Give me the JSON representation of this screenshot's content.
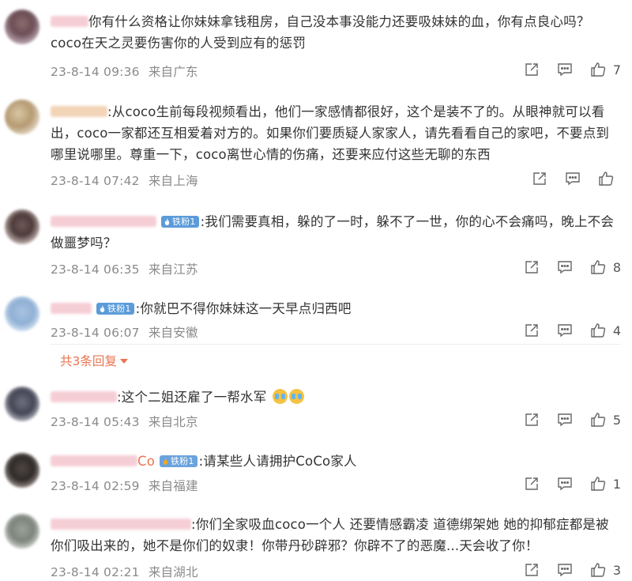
{
  "comments": [
    {
      "text_main": "你有什么资格让你妹妹拿钱租房，自己没本事没能力还要吸妹妹的血，你有点良心吗？",
      "text_line2": "coco在天之灵要伤害你的人受到应有的惩罚",
      "time": "23-8-14 09:36",
      "location": "来自广东",
      "likes": "7"
    },
    {
      "text": ":从coco生前每段视频看出，他们一家感情都很好，这个是装不了的。从眼神就可以看出，coco一家都还互相爱着对方的。如果你们要质疑人家家人，请先看看自己的家吧，不要点到哪里说哪里。尊重一下，coco离世心情的伤痛，还要来应付这些无聊的东西",
      "time": "23-8-14 07:42",
      "location": "来自上海",
      "likes": ""
    },
    {
      "badge": "铁粉1",
      "text": ":我们需要真相，躲的了一时，躲不了一世，你的心不会痛吗，晚上不会做噩梦吗？",
      "time": "23-8-14 06:35",
      "location": "来自江苏",
      "likes": "8"
    },
    {
      "badge": "铁粉1",
      "text": ":你就巴不得你妹妹这一天早点归西吧",
      "time": "23-8-14 06:07",
      "location": "来自安徽",
      "likes": "4",
      "replies_label": "共3条回复"
    },
    {
      "text": ":这个二姐还雇了一帮水军",
      "time": "23-8-14 05:43",
      "location": "来自北京",
      "likes": "5"
    },
    {
      "user_tail": "Co",
      "badge": "铁粉1",
      "text": ":请某些人请拥护CoCo家人",
      "time": "23-8-14 02:59",
      "location": "来自福建",
      "likes": "1"
    },
    {
      "text": ":你们全家吸血coco一个人 还要情感霸凌 道德绑架她 她的抑郁症都是被你们吸出来的，她不是你们的奴隶！你带丹砂辟邪？你辟不了的恶魔...天会收了你！",
      "time": "23-8-14 02:21",
      "location": "来自湖北",
      "likes": "3"
    }
  ],
  "icons": {
    "share": "share-icon",
    "comment": "comment-icon",
    "like": "thumbs-up-icon"
  },
  "colors": {
    "accent": "#eb7350",
    "meta": "#8a8a8a",
    "badge": "#5b9bd9"
  }
}
